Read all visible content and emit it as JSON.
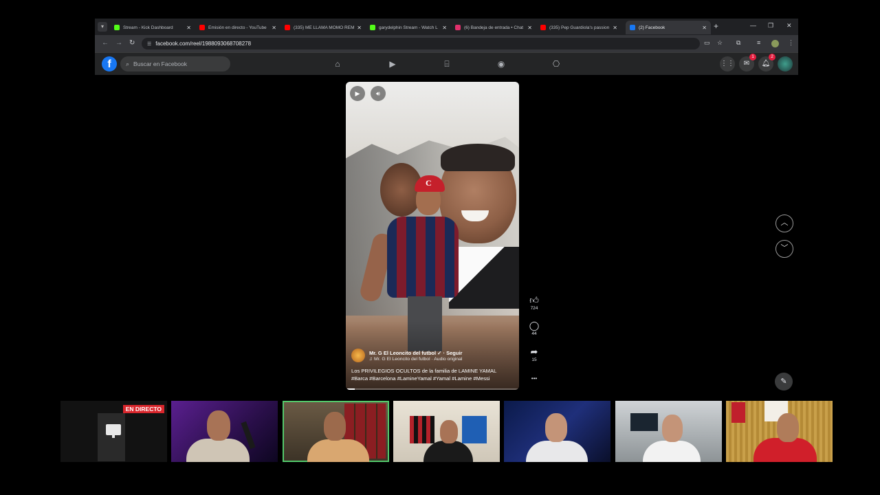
{
  "browser": {
    "tabs": [
      {
        "title": "Stream - Kick Dashboard",
        "favicon_color": "#53fc18",
        "active": false
      },
      {
        "title": "Emisión en directo - YouTube",
        "favicon_color": "#ff0000",
        "active": false
      },
      {
        "title": "(335) ME LLAMA MOMO REM",
        "favicon_color": "#ff0000",
        "active": false
      },
      {
        "title": "garydelphin Stream - Watch L",
        "favicon_color": "#53fc18",
        "active": false
      },
      {
        "title": "(6) Bandeja de entrada • Chat",
        "favicon_color": "#e1306c",
        "active": false
      },
      {
        "title": "(335) Pep Guardiola's passion",
        "favicon_color": "#ff0000",
        "active": false
      },
      {
        "title": "(2) Facebook",
        "favicon_color": "#1877f2",
        "active": true
      }
    ],
    "new_tab": "+",
    "url": "facebook.com/reel/1988093068708278"
  },
  "facebook": {
    "logo": "f",
    "search_placeholder": "Buscar en Facebook",
    "nav_icons": [
      "home-icon",
      "video-icon",
      "marketplace-icon",
      "groups-icon",
      "gaming-icon"
    ],
    "messenger_badge": "1",
    "notifications_badge": "2"
  },
  "reel": {
    "author": "Mr. G El Leoncito del futbol ✓ · Seguir",
    "audio": "♫ Mr. G El Leoncito del futbol · Audio original",
    "caption_line1": "Los PRIVILEGIOS OCULTOS de la familia de LAMINE YAMAL",
    "caption_line2": "#Barca #Barcelona #LamineYamal #Yamal #Lamine #Messi",
    "progress": 0.05,
    "likes": "724",
    "comments": "44",
    "shares": "15",
    "more": "•••"
  },
  "stream": {
    "live_label": "EN DIRECTO"
  },
  "colors": {
    "facebook_blue": "#1877f2",
    "live_red": "#d9262c",
    "selected_cam": "#53c96b"
  }
}
